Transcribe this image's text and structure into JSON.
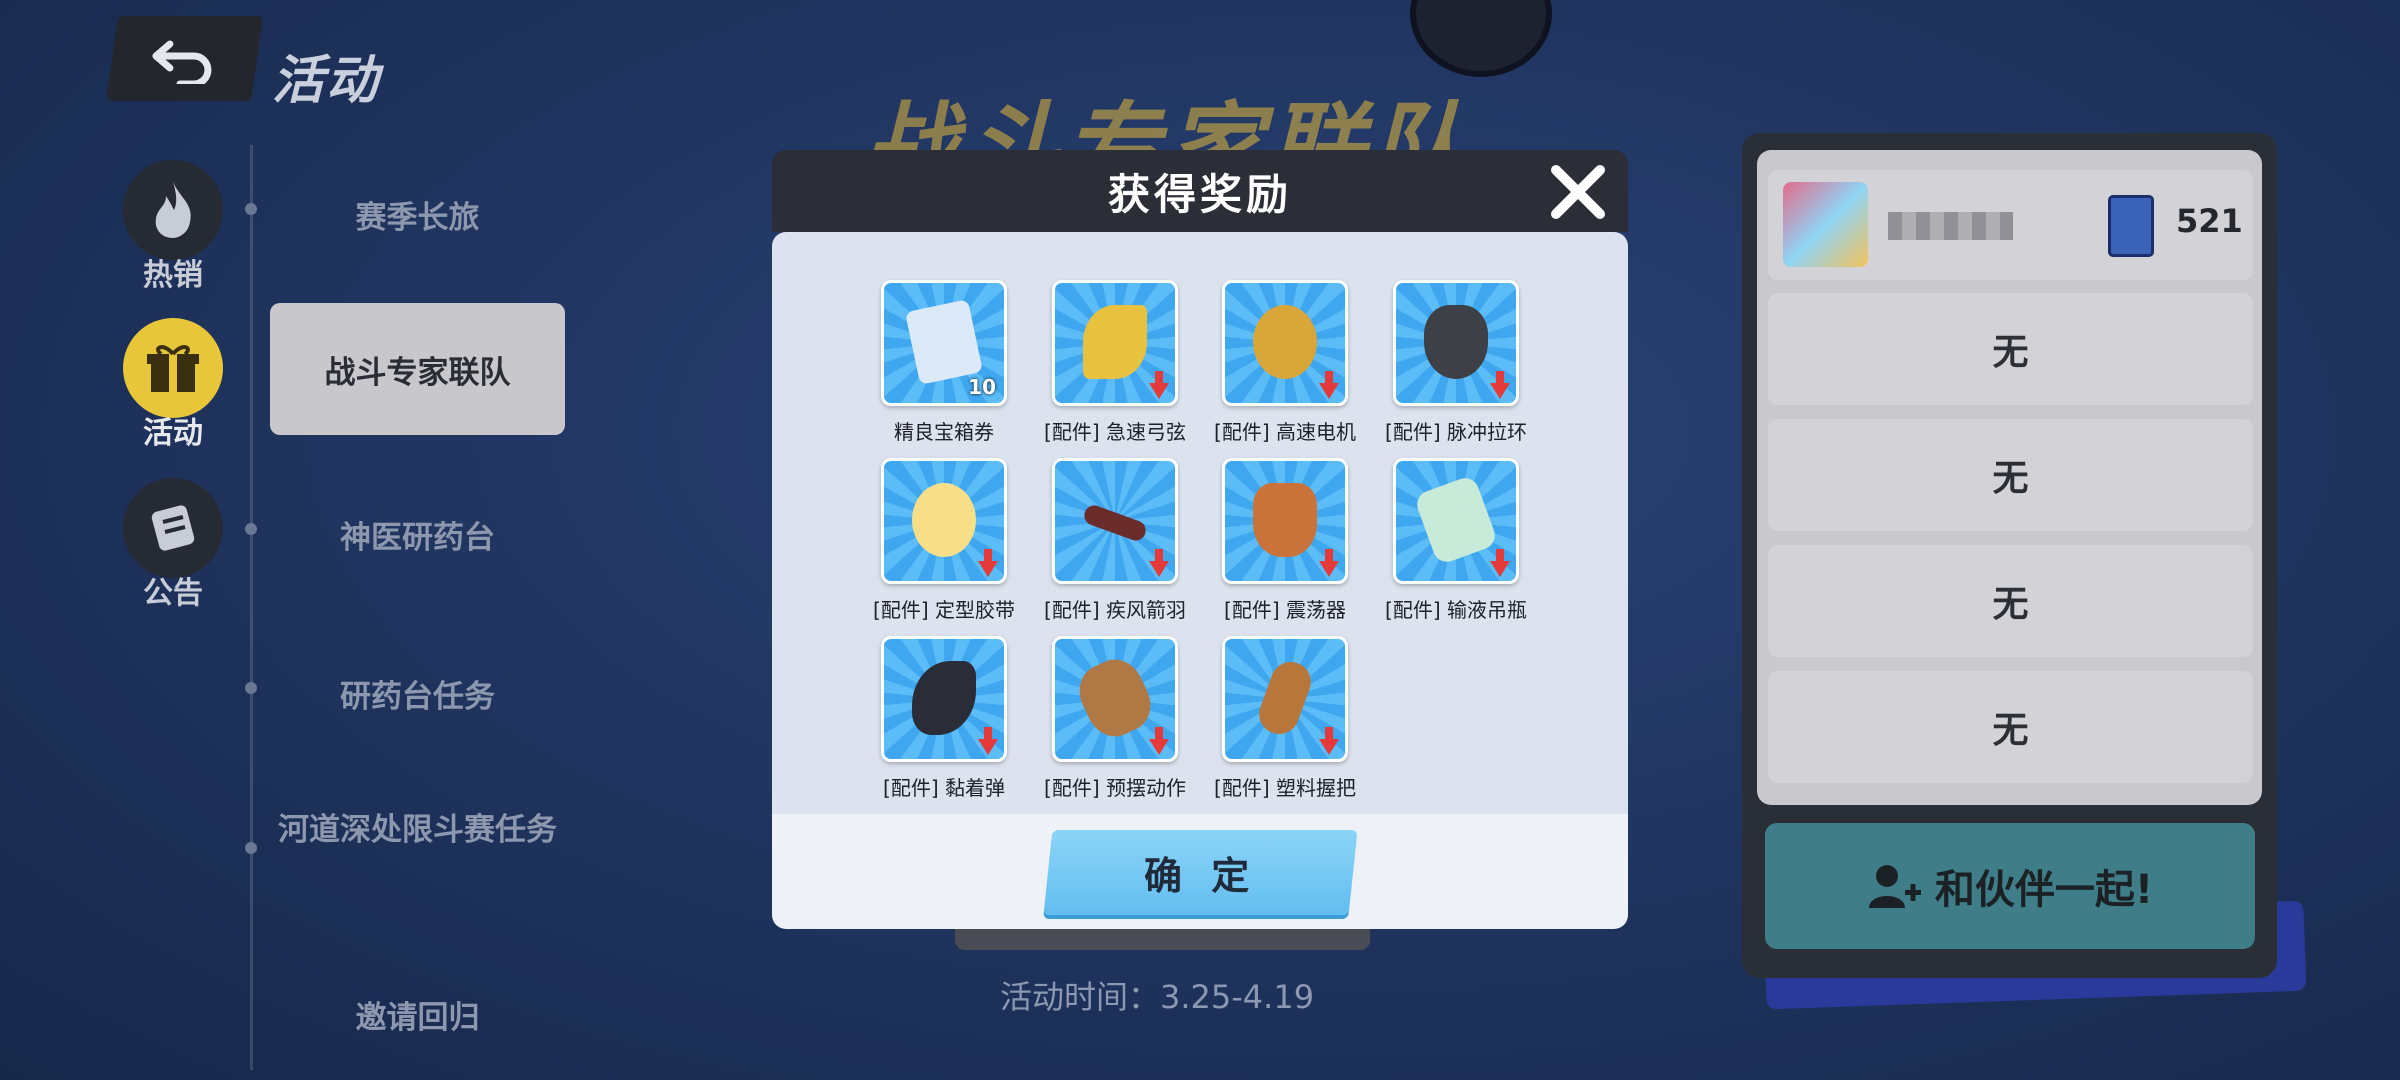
{
  "header": {
    "title": "活动"
  },
  "nav": {
    "tabs": [
      {
        "label": "热销",
        "icon": "flame-icon"
      },
      {
        "label": "活动",
        "icon": "gift-icon"
      },
      {
        "label": "公告",
        "icon": "scroll-icon"
      }
    ],
    "sub_items": [
      "赛季长旅",
      "战斗专家联队",
      "神医研药台",
      "研药台任务",
      "河道深处限斗赛任务",
      "邀请回归"
    ],
    "active_sub": "战斗专家联队"
  },
  "banner": {
    "title": "战斗专家联队",
    "activity_time": "活动时间：3.25-4.19"
  },
  "right_panel": {
    "player_count": "521",
    "slots": [
      "无",
      "无",
      "无",
      "无"
    ],
    "partner_button": "和伙伴一起!"
  },
  "modal": {
    "title": "获得奖励",
    "confirm_label": "确 定",
    "items": [
      {
        "label": "精良宝箱券",
        "qty": "10",
        "color": "#dceaf7"
      },
      {
        "label": "[配件] 急速弓弦",
        "qty": "",
        "color": "#e8c13e"
      },
      {
        "label": "[配件] 高速电机",
        "qty": "",
        "color": "#d9a63a"
      },
      {
        "label": "[配件] 脉冲拉环",
        "qty": "",
        "color": "#3d4047"
      },
      {
        "label": "[配件] 定型胶带",
        "qty": "",
        "color": "#f7df8a"
      },
      {
        "label": "[配件] 疾风箭羽",
        "qty": "",
        "color": "#6b2c2c"
      },
      {
        "label": "[配件] 震荡器",
        "qty": "",
        "color": "#c9733a"
      },
      {
        "label": "[配件] 输液吊瓶",
        "qty": "",
        "color": "#c8ead8"
      },
      {
        "label": "[配件] 黏着弹",
        "qty": "",
        "color": "#2a2d38"
      },
      {
        "label": "[配件] 预摆动作",
        "qty": "",
        "color": "#b07845"
      },
      {
        "label": "[配件] 塑料握把",
        "qty": "",
        "color": "#b8763a"
      }
    ]
  }
}
